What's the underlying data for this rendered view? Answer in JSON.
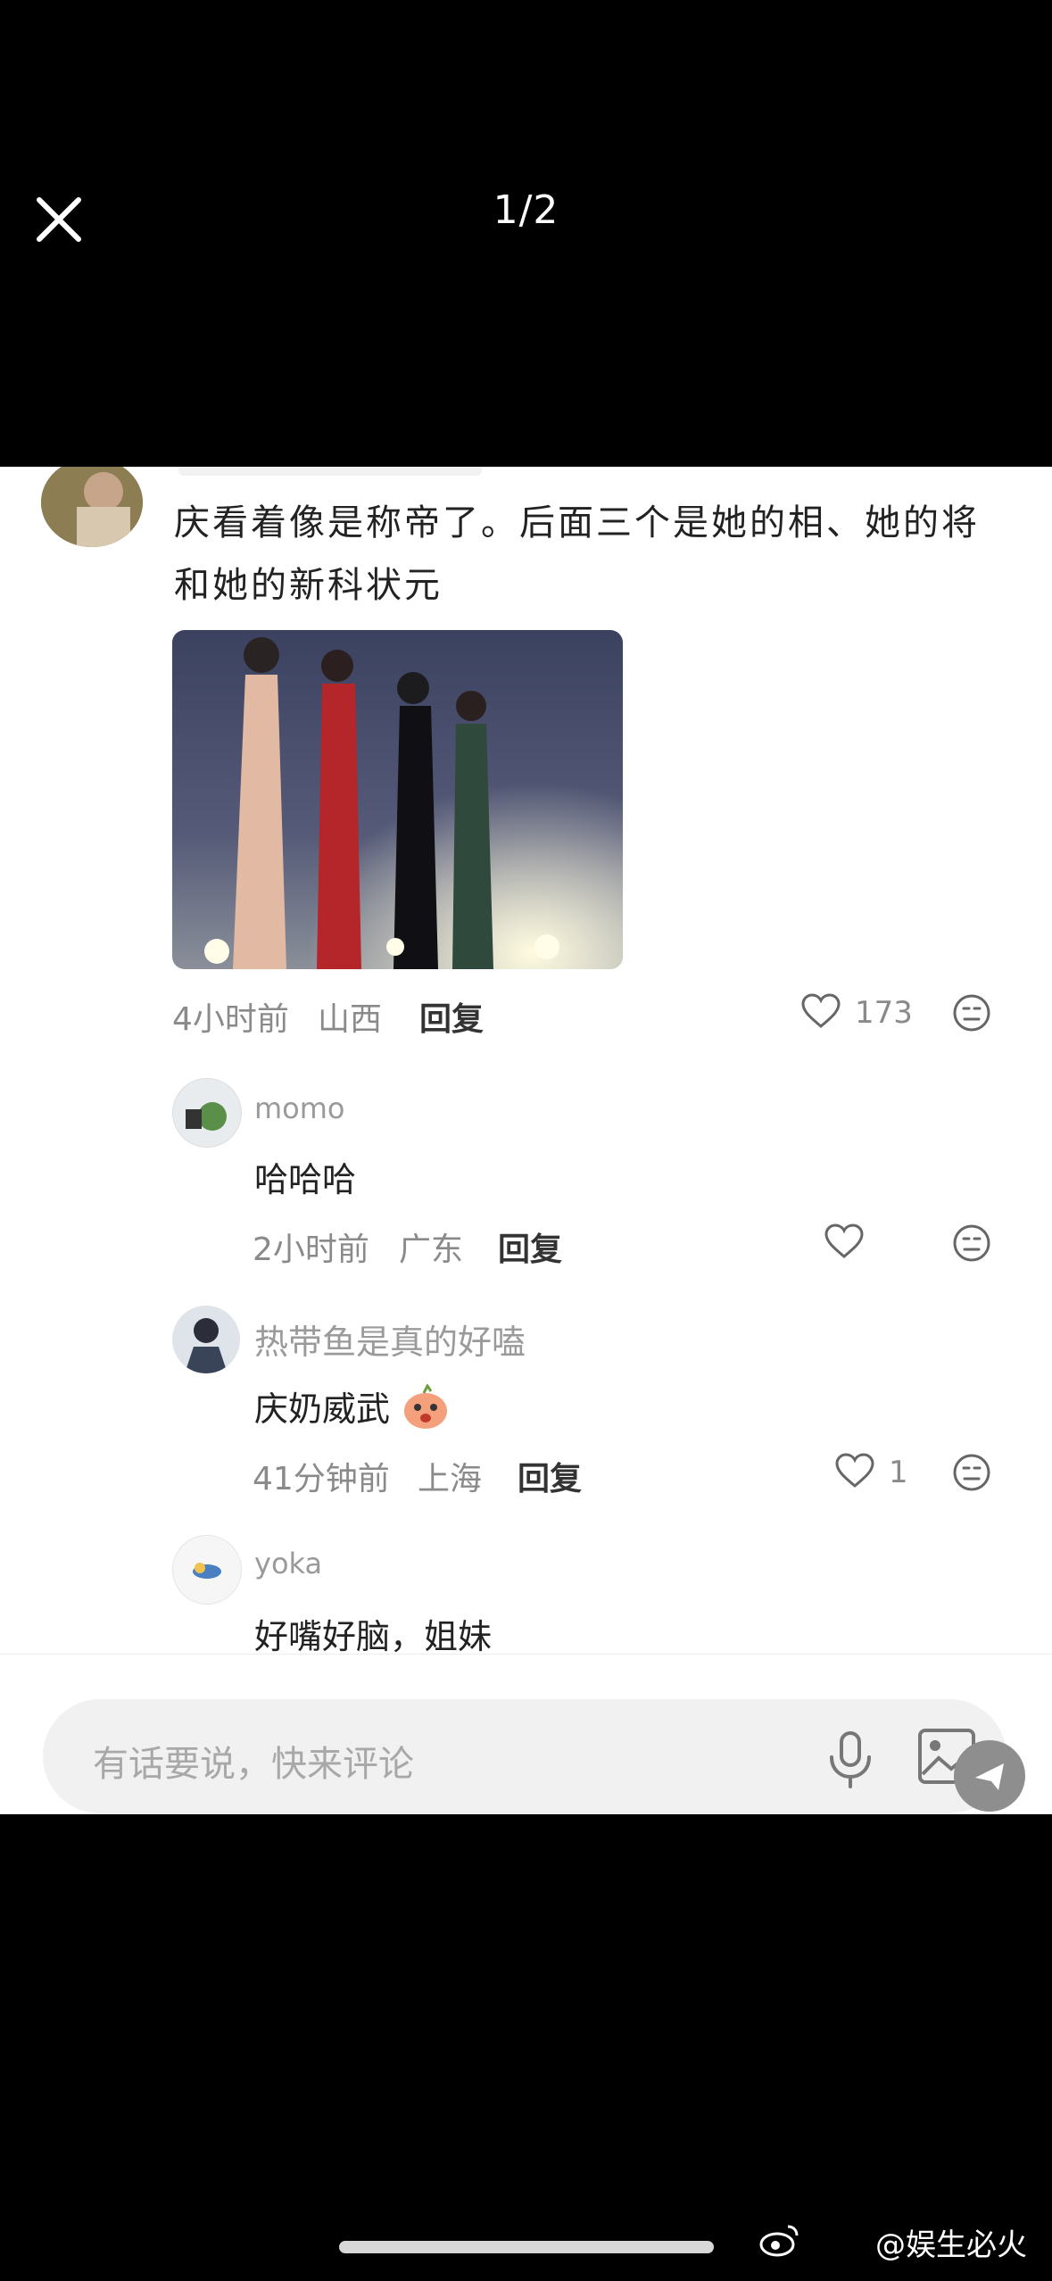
{
  "viewer": {
    "counter": "1/2"
  },
  "post": {
    "text_line1": "庆看着像是称帝了。后面三个是她的相、她的将",
    "text_line2": "和她的新科状元",
    "time": "4小时前",
    "location": "山西",
    "reply_label": "回复",
    "like_count": "173"
  },
  "replies": [
    {
      "username": "momo",
      "text": "哈哈哈",
      "time": "2小时前",
      "location": "广东",
      "reply_label": "回复",
      "like_count": ""
    },
    {
      "username": "热带鱼是真的好嗑",
      "text": "庆奶威武",
      "time": "41分钟前",
      "location": "上海",
      "reply_label": "回复",
      "like_count": "1"
    },
    {
      "username": "yoka",
      "text": "好嘴好脑，姐妹"
    }
  ],
  "composer": {
    "placeholder": "有话要说，快来评论"
  },
  "watermark": "@娱生必火",
  "icons": [
    "close-icon",
    "heart-icon",
    "dislike-face-icon",
    "microphone-icon",
    "image-icon",
    "send-icon",
    "weibo-logo-icon"
  ],
  "colors": {
    "background": "#000000",
    "panel": "#ffffff",
    "meta_text": "#8a8a8a",
    "input_bg": "#f1f1f1"
  }
}
